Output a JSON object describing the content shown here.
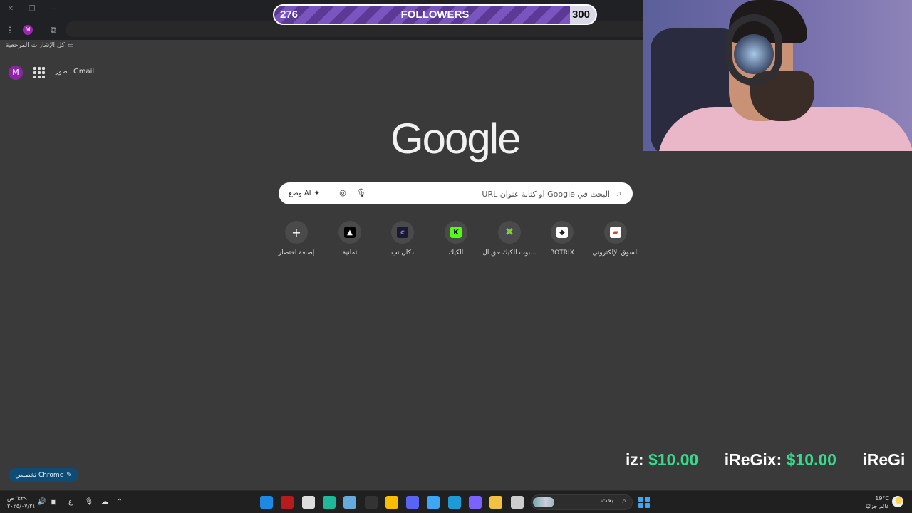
{
  "browser": {
    "avatar_letter": "M",
    "bookmarks": {
      "all_bookmarks_label": "كل الإشارات المرجعية"
    }
  },
  "google": {
    "logo": "Google",
    "gmail_link": "Gmail",
    "images_link": "صور",
    "avatar_letter": "M",
    "search_placeholder": "البحث في Google أو كتابة عنوان URL",
    "ai_mode_label": "وضع AI",
    "shortcuts": [
      {
        "label": "السوق الإلكتروني",
        "icon": "market-icon",
        "color": "#e53935"
      },
      {
        "label": "BOTRIX",
        "icon": "botrix-icon",
        "color": "#ffffff"
      },
      {
        "label": "بوت الكيك حق ال...",
        "icon": "kick-bot-icon",
        "color": "#7cd321"
      },
      {
        "label": "الكيك",
        "icon": "kick-icon",
        "color": "#53fc18"
      },
      {
        "label": "دكان تب",
        "icon": "dukan-icon",
        "color": "#6a3fd8"
      },
      {
        "label": "ثمانية",
        "icon": "thmanyah-icon",
        "color": "#000000"
      },
      {
        "label": "إضافة اختصار",
        "icon": "plus-icon",
        "color": "#ffffff"
      }
    ],
    "customize_label": "تخصيص Chrome"
  },
  "followers_goal": {
    "current": "276",
    "title": "FOLLOWERS",
    "goal": "300",
    "progress": 0.92
  },
  "donation_ticker": [
    {
      "name": "iz:",
      "amount": "$10.00"
    },
    {
      "name": "iReGix:",
      "amount": "$10.00"
    },
    {
      "name": "iReGi",
      "amount": ""
    }
  ],
  "taskbar": {
    "time": "٦:٣٩ ص",
    "date": "٢٠٢٥/٠٧/٢١",
    "lang": "ع",
    "search_label": "بحث",
    "weather_temp": "19°C",
    "weather_desc": "غائم جزئيًا",
    "apps": [
      {
        "name": "outlook-icon",
        "color": "#1e88e5"
      },
      {
        "name": "acrobat-icon",
        "color": "#b71c1c"
      },
      {
        "name": "obs-icon",
        "color": "#dddddd"
      },
      {
        "name": "terminal-icon",
        "color": "#1fb89a"
      },
      {
        "name": "steam-icon",
        "color": "#66aadd"
      },
      {
        "name": "epic-icon",
        "color": "#333333"
      },
      {
        "name": "chrome-icon",
        "color": "#fbbc04"
      },
      {
        "name": "discord-icon",
        "color": "#5865f2"
      },
      {
        "name": "store-icon",
        "color": "#3ea7f5"
      },
      {
        "name": "edge-icon",
        "color": "#1e9bd7"
      },
      {
        "name": "m365-icon",
        "color": "#7b61ff"
      },
      {
        "name": "explorer-icon",
        "color": "#f4c142"
      },
      {
        "name": "notepad-icon",
        "color": "#cccccc"
      }
    ]
  }
}
